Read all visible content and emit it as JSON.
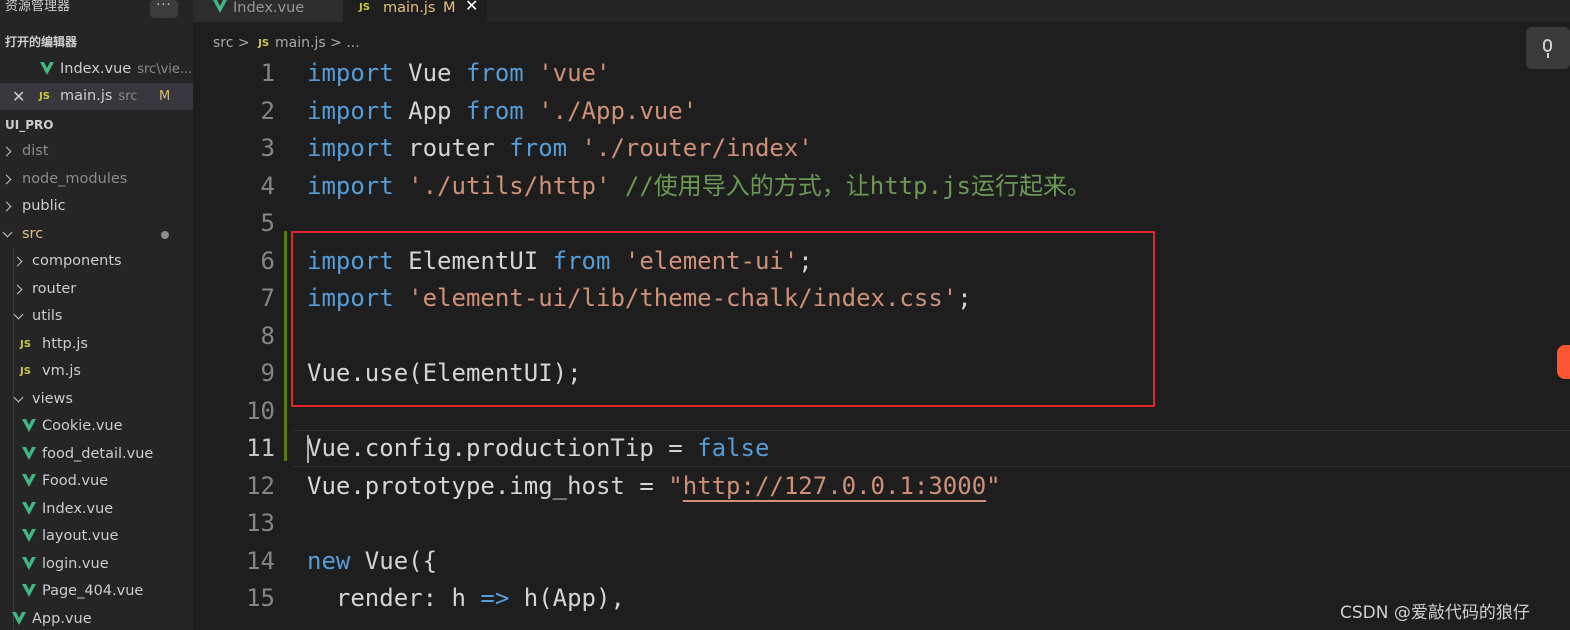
{
  "sidebar": {
    "title": "资源管理器",
    "more": "···",
    "open_editors_header": "打开的编辑器",
    "open_editors": [
      {
        "name": "Index.vue",
        "desc": "src\\vie..."
      },
      {
        "name": "main.js",
        "desc": "src",
        "badge": "M"
      }
    ],
    "project_header": "UI_PRO",
    "tree": [
      "dist",
      "node_modules",
      "public",
      "src",
      "components",
      "router",
      "utils",
      "http.js",
      "vm.js",
      "views",
      "Cookie.vue",
      "food_detail.vue",
      "Food.vue",
      "Index.vue",
      "layout.vue",
      "login.vue",
      "Page_404.vue",
      "App.vue"
    ]
  },
  "tabs": [
    {
      "label": "Index.vue"
    },
    {
      "label": "main.js",
      "badge": "M",
      "close": "✕"
    }
  ],
  "breadcrumb": {
    "root": "src",
    "file": "main.js",
    "rest": "..."
  },
  "icons": {
    "js": "JS",
    "sep": ">"
  },
  "editor": {
    "line_numbers": [
      "1",
      "2",
      "3",
      "4",
      "5",
      "6",
      "7",
      "8",
      "9",
      "10",
      "11",
      "12",
      "13",
      "14",
      "15"
    ],
    "current_line": 11,
    "lines": {
      "l1": [
        "import",
        " Vue ",
        "from",
        " ",
        "'vue'"
      ],
      "l2": [
        "import",
        " App ",
        "from",
        " ",
        "'./App.vue'"
      ],
      "l3": [
        "import",
        " router ",
        "from",
        " ",
        "'./router/index'"
      ],
      "l4": [
        "import",
        " ",
        "'./utils/http'",
        " ",
        "//使用导入的方式，让http.js运行起来。"
      ],
      "l6": [
        "import",
        " ElementUI ",
        "from",
        " ",
        "'element-ui'",
        ";"
      ],
      "l7": [
        "import",
        " ",
        "'element-ui/lib/theme-chalk/index.css'",
        ";"
      ],
      "l9": [
        "Vue.use(ElementUI);"
      ],
      "l11": [
        "Vue.config.productionTip",
        " = ",
        "false"
      ],
      "l12": [
        "Vue.prototype.img_host",
        " = ",
        "\"",
        "http://127.0.0.1:3000",
        "\""
      ],
      "l14": [
        "new",
        " Vue({"
      ],
      "l15": [
        "  render",
        ": h ",
        "=>",
        " h(App),"
      ]
    }
  },
  "watermark": "CSDN @爱敲代码的狼仔",
  "colors": {
    "keyword": "#569cd6",
    "string": "#ce9178",
    "comment": "#6a9955",
    "highlight_box": "#e0262d",
    "vue_icon": "#41b883",
    "js_icon": "#cbcb41"
  }
}
